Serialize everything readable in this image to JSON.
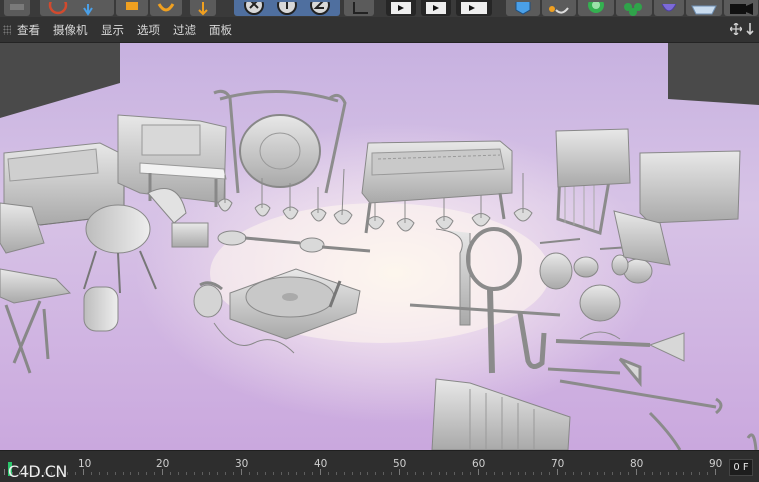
{
  "menu": {
    "items": [
      "查看",
      "摄像机",
      "显示",
      "选项",
      "过滤",
      "面板"
    ]
  },
  "toolbar": {
    "icons": [
      "move-icon",
      "scale-icon",
      "rotate-icon",
      "undo-icon",
      "x-axis-icon",
      "y-axis-icon",
      "z-axis-icon",
      "coordinate-icon",
      "render-view-icon",
      "render-picture-icon",
      "render-settings-icon",
      "cube-icon",
      "pen-icon",
      "subdivision-icon",
      "cloner-icon",
      "deformer-icon",
      "floor-icon",
      "camera-icon"
    ]
  },
  "timeline": {
    "labels": [
      "10",
      "20",
      "30",
      "40",
      "50",
      "60",
      "70",
      "80",
      "90"
    ],
    "current_frame": "0 F",
    "watermark": "C4D.CN"
  },
  "colors": {
    "viewport_purple": "#c7b1e0",
    "toolbar_blue": "#4f6f9f",
    "playhead": "#2bc46b"
  }
}
